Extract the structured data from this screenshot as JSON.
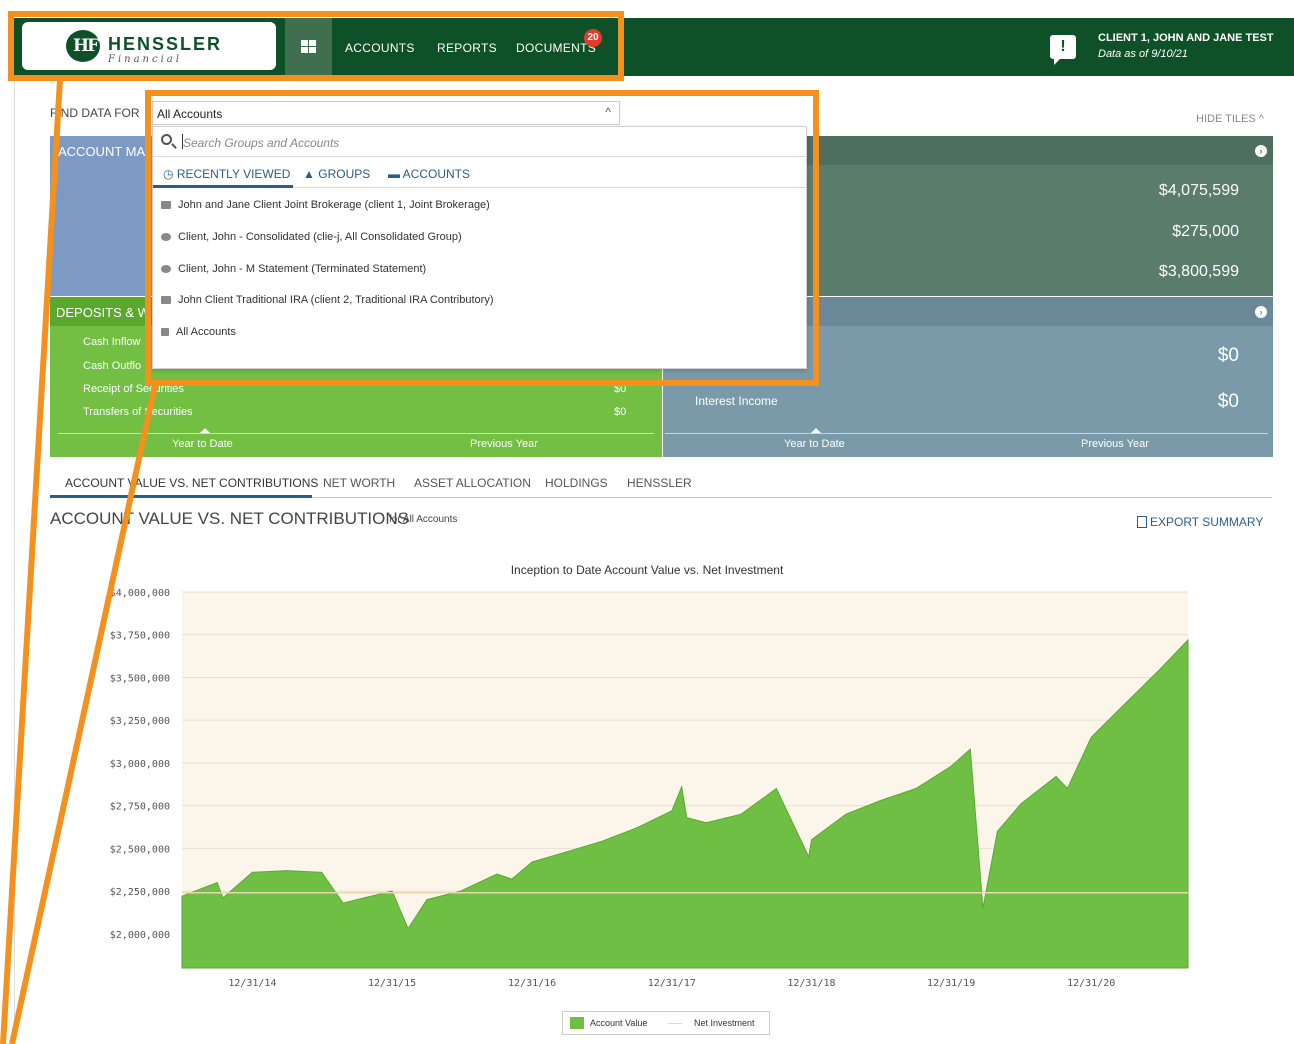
{
  "header": {
    "logo_text": "HENSSLER",
    "logo_sub": "Financial",
    "nav": [
      "ACCOUNTS",
      "REPORTS",
      "DOCUMENTS"
    ],
    "documents_badge": "20",
    "client_name": "CLIENT 1, JOHN AND JANE TEST",
    "data_as_of": "Data as of 9/10/21"
  },
  "filter": {
    "label": "FIND DATA FOR",
    "selected": "All Accounts",
    "hide_tiles": "HIDE TILES"
  },
  "dropdown": {
    "search_placeholder": "Search Groups and Accounts",
    "tabs": [
      "RECENTLY VIEWED",
      "GROUPS",
      "ACCOUNTS"
    ],
    "items": [
      {
        "label": "John and Jane Client Joint Brokerage (client 1, Joint Brokerage)",
        "icon": "briefcase-icon"
      },
      {
        "label": "Client, John - Consolidated (clie-j, All Consolidated Group)",
        "icon": "group-icon"
      },
      {
        "label": "Client, John - M Statement (Terminated Statement)",
        "icon": "group-icon"
      },
      {
        "label": "John Client Traditional IRA (client 2, Traditional IRA Contributory)",
        "icon": "briefcase-icon"
      },
      {
        "label": "All Accounts",
        "icon": "home-icon"
      }
    ]
  },
  "tiles": {
    "account_title": "ACCOUNT MA",
    "account_values": [
      "$4,075,599",
      "$275,000",
      "$3,800,599"
    ],
    "deposits_title": "DEPOSITS & W",
    "deposits_rows": [
      {
        "label": "Cash Inflow",
        "value": ""
      },
      {
        "label": "Cash Outflo",
        "value": ""
      },
      {
        "label": "Receipt of Securities",
        "value": "$0"
      },
      {
        "label": "Transfers of Securities",
        "value": "$0"
      }
    ],
    "income_values": [
      "$0",
      "$0"
    ],
    "income_label": "Interest Income",
    "tab_ytd": "Year to Date",
    "tab_prev": "Previous Year"
  },
  "section_tabs": [
    "ACCOUNT VALUE VS. NET CONTRIBUTIONS",
    "NET WORTH",
    "ASSET ALLOCATION",
    "HOLDINGS",
    "HENSSLER"
  ],
  "chart_heading": "ACCOUNT VALUE VS. NET CONTRIBUTIONS",
  "chart_for": "for All Accounts",
  "export_label": "EXPORT SUMMARY",
  "colors": {
    "nav_green": "#0e5128",
    "account_value_green": "#6fbf44",
    "highlight_orange": "#f4901e",
    "link_blue": "#2a5d8a"
  },
  "chart_data": {
    "type": "area",
    "title": "Inception to Date Account Value vs. Net Investment",
    "xlabel": "",
    "ylabel": "",
    "x_ticks": [
      "12/31/14",
      "12/31/15",
      "12/31/16",
      "12/31/17",
      "12/31/18",
      "12/31/19",
      "12/31/20"
    ],
    "y_ticks": [
      "$4,000,000",
      "$3,750,000",
      "$3,500,000",
      "$3,250,000",
      "$3,000,000",
      "$2,750,000",
      "$2,500,000",
      "$2,250,000",
      "$2,000,000"
    ],
    "ylim": [
      1800000,
      4000000
    ],
    "xlim": [
      "2014-06-30",
      "2021-09-10"
    ],
    "series": [
      {
        "name": "Account Value",
        "x": [
          "2014-06-30",
          "2014-09-30",
          "2014-10-15",
          "2014-12-31",
          "2015-03-31",
          "2015-06-30",
          "2015-08-25",
          "2015-09-30",
          "2015-12-31",
          "2016-02-11",
          "2016-03-31",
          "2016-06-27",
          "2016-09-30",
          "2016-11-08",
          "2016-12-31",
          "2017-03-31",
          "2017-06-30",
          "2017-09-30",
          "2017-12-31",
          "2018-01-26",
          "2018-02-08",
          "2018-03-31",
          "2018-06-30",
          "2018-09-30",
          "2018-12-24",
          "2018-12-31",
          "2019-03-31",
          "2019-06-30",
          "2019-09-30",
          "2019-12-31",
          "2020-02-19",
          "2020-03-23",
          "2020-04-30",
          "2020-06-30",
          "2020-09-30",
          "2020-10-30",
          "2020-12-31",
          "2021-03-31",
          "2021-06-30",
          "2021-09-10"
        ],
        "values": [
          2220000,
          2300000,
          2210000,
          2360000,
          2370000,
          2360000,
          2180000,
          2200000,
          2250000,
          2030000,
          2200000,
          2250000,
          2350000,
          2320000,
          2420000,
          2480000,
          2540000,
          2620000,
          2720000,
          2860000,
          2680000,
          2650000,
          2700000,
          2850000,
          2450000,
          2550000,
          2700000,
          2780000,
          2850000,
          2980000,
          3080000,
          2150000,
          2600000,
          2760000,
          2920000,
          2850000,
          3150000,
          3350000,
          3550000,
          3720000
        ]
      },
      {
        "name": "Net Investment",
        "x": [
          "2014-06-30",
          "2021-09-10"
        ],
        "values": [
          2240000,
          2240000
        ]
      }
    ],
    "grid": true,
    "legend": "bottom"
  }
}
